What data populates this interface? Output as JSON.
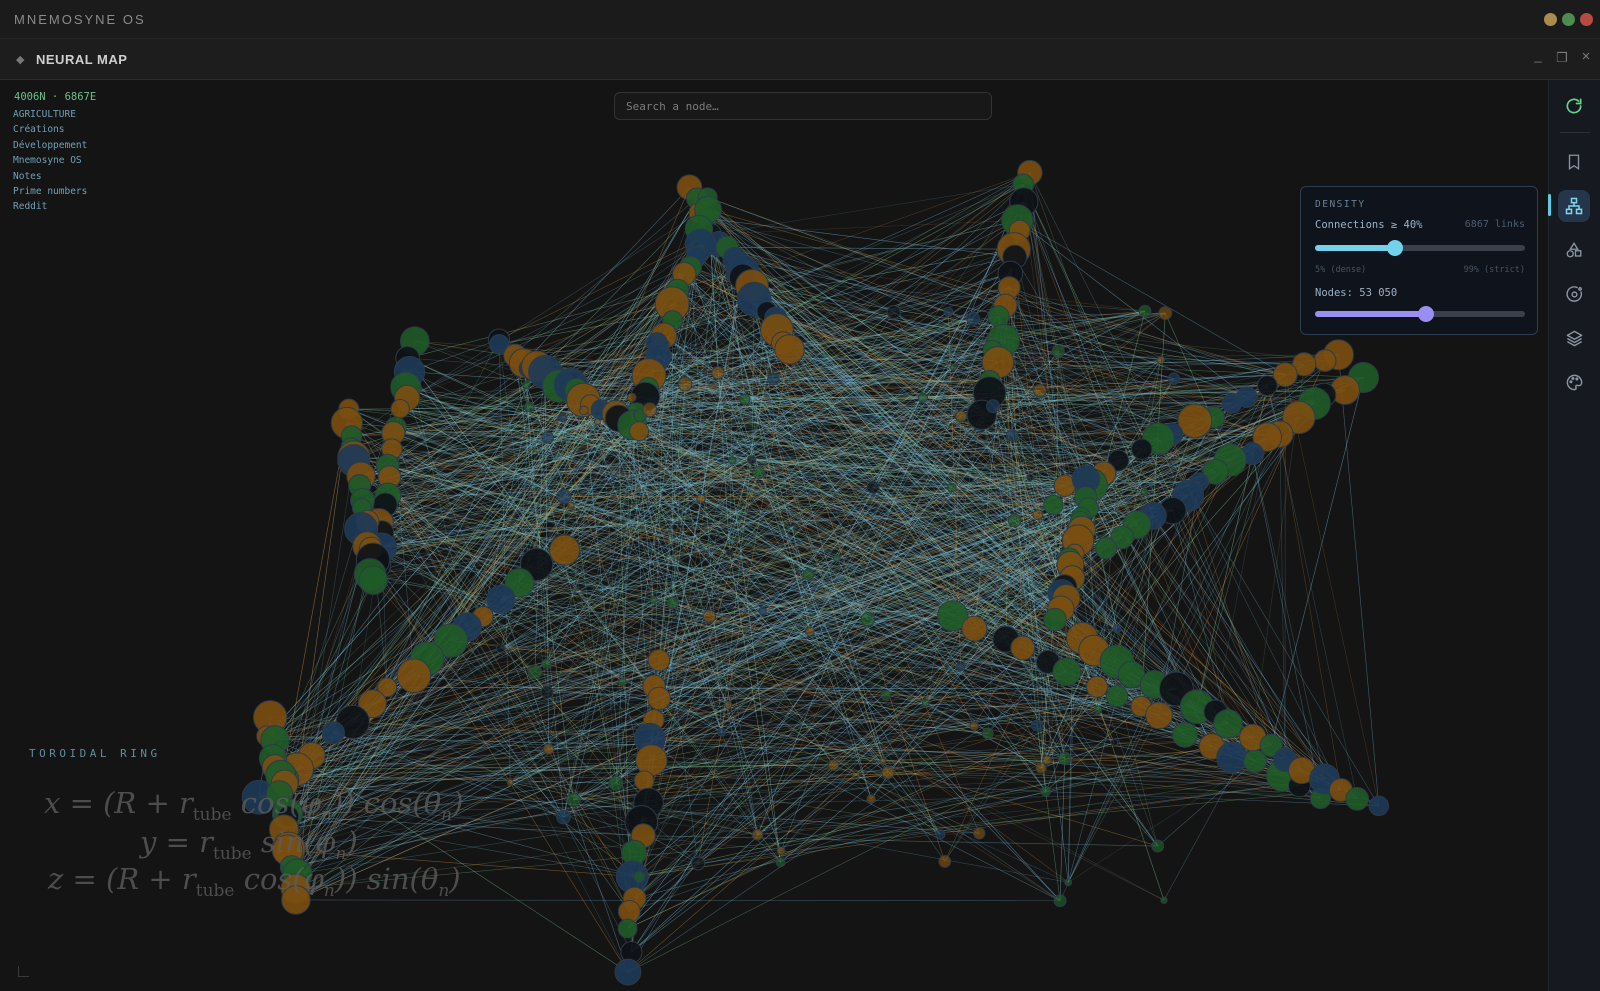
{
  "os": {
    "title": "MNEMOSYNE OS",
    "traffic_colors": [
      "#a98c4e",
      "#4f8a4e",
      "#b84a44"
    ]
  },
  "window": {
    "title": "NEURAL MAP",
    "icon": "diamond-icon",
    "controls": {
      "minimize": "_",
      "maximize": "❐",
      "close": "×"
    }
  },
  "map": {
    "coords": "4006N · 6867E",
    "tags": [
      "AGRICULTURE",
      "Créations",
      "Développement",
      "Mnemosyne OS",
      "Notes",
      "Prime numbers",
      "Reddit"
    ],
    "search_placeholder": "Search a node…",
    "colors": {
      "link_blue": "#7fc4e3",
      "link_orange": "#c8893e",
      "link_green": "#8fd39a",
      "node_green": "#1f5a27",
      "node_orange": "#7a4e10",
      "node_blue": "#1d3a58",
      "node_dark": "#0e1217"
    }
  },
  "density_panel": {
    "heading": "DENSITY",
    "connections_label": "Connections ≥ 40%",
    "links_label": "6867 links",
    "connections_value": 0.38,
    "min_label": "5% (dense)",
    "max_label": "99% (strict)",
    "nodes_label": "Nodes: 53 050",
    "nodes_value": 0.53,
    "connections_color": "#72d2ea",
    "nodes_color": "#9b8ef0"
  },
  "rail": {
    "items": [
      "refresh-icon",
      "bookmark-icon",
      "network-icon",
      "shapes-icon",
      "orbit-icon",
      "layers-icon",
      "palette-icon"
    ],
    "active": "network-icon",
    "accent": "#5ecbe6"
  },
  "formula": {
    "label": "TOROIDAL RING",
    "line1_pre": "x = (R + r",
    "line1_post": " cos(φ",
    "line1_end": ")) cos(θ",
    "line2_pre": "y = r",
    "line2_post": " sin(φ",
    "line3_pre": "z = (R + r",
    "line3_post": " cos(φ",
    "line3_end": ")) sin(θ",
    "sub_tube": "tube",
    "sub_n": "n",
    "close": ")"
  }
}
